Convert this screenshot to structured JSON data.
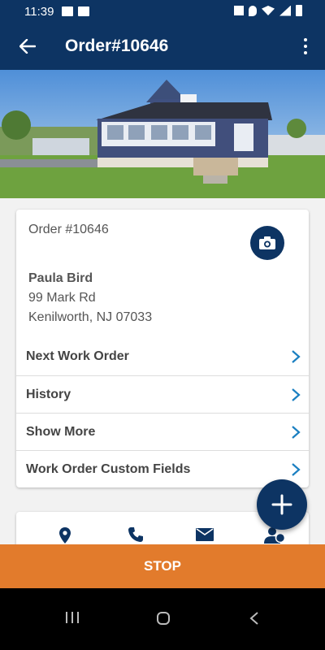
{
  "status": {
    "time": "11:39"
  },
  "header": {
    "title": "Order#10646"
  },
  "order": {
    "label": "Order #10646",
    "customer_name": "Paula Bird",
    "address_line1": "99 Mark Rd",
    "address_line2": "Kenilworth, NJ 07033"
  },
  "menu": [
    {
      "label": "Next Work Order"
    },
    {
      "label": "History"
    },
    {
      "label": "Show More"
    },
    {
      "label": "Work Order Custom Fields"
    }
  ],
  "actions": {
    "stop_label": "STOP"
  },
  "colors": {
    "primary": "#0d3463",
    "accent": "#e27b2c",
    "chevron": "#1a7fc1"
  },
  "icons": [
    "back-arrow-icon",
    "more-vertical-icon",
    "camera-icon",
    "chevron-right-icon",
    "location-pin-icon",
    "phone-icon",
    "mail-icon",
    "user-badge-icon",
    "plus-icon"
  ]
}
